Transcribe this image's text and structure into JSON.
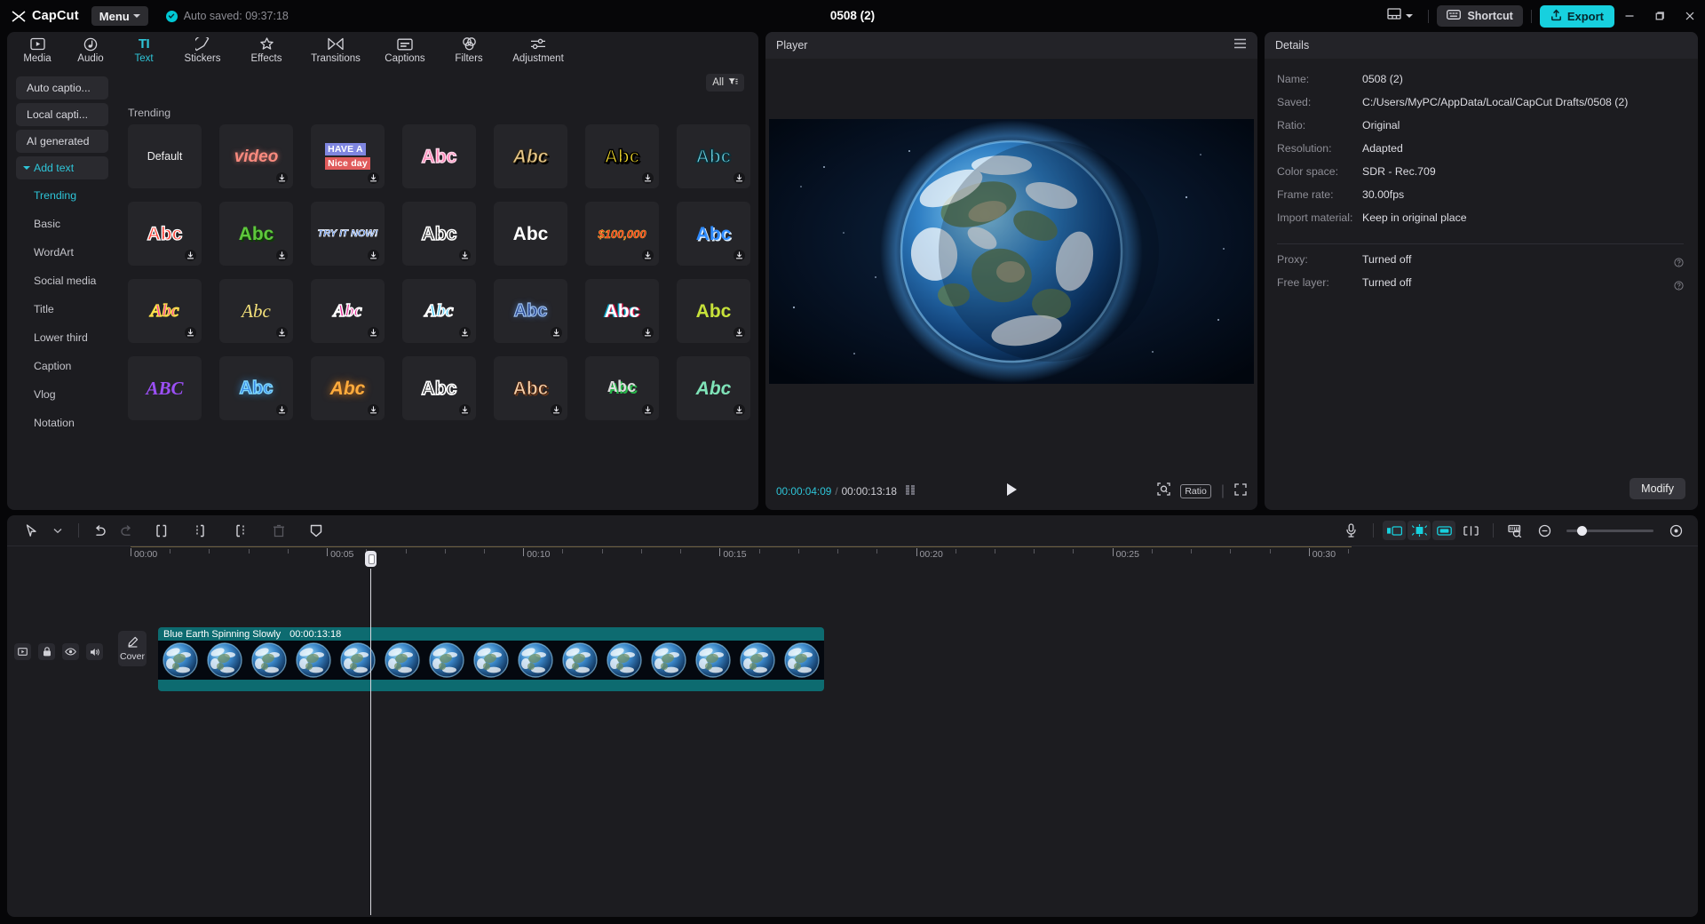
{
  "app": {
    "brand": "CapCut",
    "menu_label": "Menu",
    "autosave": "Auto  saved: 09:37:18",
    "project_title": "0508 (2)",
    "accent": "#17d0de",
    "clip_color": "#0d6b70"
  },
  "titlebar": {
    "layout_icon": "layout-icon",
    "shortcut_label": "Shortcut",
    "shortcut_icon": "keyboard-icon",
    "export_label": "Export",
    "export_icon": "upload-icon",
    "minimize": "–",
    "maximize": "❐",
    "close": "✕"
  },
  "tabs": [
    {
      "label": "Media",
      "icon": "media-icon",
      "active": false
    },
    {
      "label": "Audio",
      "icon": "audio-icon",
      "active": false
    },
    {
      "label": "Text",
      "icon": "text-icon",
      "glyph": "TI",
      "active": true
    },
    {
      "label": "Stickers",
      "icon": "stickers-icon",
      "active": false
    },
    {
      "label": "Effects",
      "icon": "effects-icon",
      "active": false
    },
    {
      "label": "Transitions",
      "icon": "transitions-icon",
      "active": false
    },
    {
      "label": "Captions",
      "icon": "captions-icon",
      "active": false
    },
    {
      "label": "Filters",
      "icon": "filters-icon",
      "active": false
    },
    {
      "label": "Adjustment",
      "icon": "adjustment-icon",
      "active": false
    }
  ],
  "sidebar": {
    "buttons": [
      {
        "label": "Auto captio...",
        "kind": "button"
      },
      {
        "label": "Local capti...",
        "kind": "button"
      },
      {
        "label": "AI generated",
        "kind": "button"
      },
      {
        "label": "Add text",
        "kind": "button",
        "expanded": true
      }
    ],
    "items": [
      {
        "label": "Trending",
        "selected": true
      },
      {
        "label": "Basic",
        "selected": false
      },
      {
        "label": "WordArt",
        "selected": false
      },
      {
        "label": "Social media",
        "selected": false
      },
      {
        "label": "Title",
        "selected": false
      },
      {
        "label": "Lower third",
        "selected": false
      },
      {
        "label": "Caption",
        "selected": false
      },
      {
        "label": "Vlog",
        "selected": false
      },
      {
        "label": "Notation",
        "selected": false
      }
    ]
  },
  "grid": {
    "filter_label": "All",
    "filter_icon": "filter-icon",
    "section_title": "Trending",
    "download_icon": "download-icon",
    "templates": [
      {
        "text": "Default",
        "style": "default",
        "download": false
      },
      {
        "text": "video",
        "style": "video-pink",
        "download": true
      },
      {
        "text": "HAVE A / Nice day",
        "style": "have-a-nice-day",
        "download": true
      },
      {
        "text": "Abc",
        "style": "pink-outline",
        "download": false
      },
      {
        "text": "Abc",
        "style": "cream-italic-shadow",
        "download": false
      },
      {
        "text": "Abc",
        "style": "yellow-block",
        "download": true
      },
      {
        "text": "Abc",
        "style": "cyan-block",
        "download": true
      },
      {
        "text": "Abc",
        "style": "red-outline",
        "download": true
      },
      {
        "text": "Abc",
        "style": "green-block",
        "download": true
      },
      {
        "text": "TRY IT NOW!",
        "style": "try-it-now",
        "download": true
      },
      {
        "text": "Abc",
        "style": "white-outline-black",
        "download": true
      },
      {
        "text": "Abc",
        "style": "white-plain",
        "download": false
      },
      {
        "text": "$100,000",
        "style": "money-red",
        "download": true
      },
      {
        "text": "Abc",
        "style": "blue-bold",
        "download": true
      },
      {
        "text": "Abc",
        "style": "pink-script",
        "download": true
      },
      {
        "text": "Abc",
        "style": "yellow-script",
        "download": true
      },
      {
        "text": "Abc",
        "style": "magenta-script",
        "download": true
      },
      {
        "text": "Abc",
        "style": "cyan-script",
        "download": true
      },
      {
        "text": "Abc",
        "style": "navy-glow",
        "download": true
      },
      {
        "text": "Abc",
        "style": "white-glitch",
        "download": true
      },
      {
        "text": "Abc",
        "style": "lime-plain",
        "download": true
      },
      {
        "text": "ABC",
        "style": "purple-brush",
        "download": false
      },
      {
        "text": "Abc",
        "style": "blue-neon",
        "download": true
      },
      {
        "text": "Abc",
        "style": "orange-glow",
        "download": true
      },
      {
        "text": "Abc",
        "style": "black-white-outline",
        "download": true
      },
      {
        "text": "Abc",
        "style": "peach-3d",
        "download": true
      },
      {
        "text": "Abc",
        "style": "green-pixel",
        "download": true
      },
      {
        "text": "Abc",
        "style": "mint-italic",
        "download": true
      }
    ]
  },
  "player": {
    "title": "Player",
    "menu_icon": "hamburger-icon",
    "current_time": "00:00:04:09",
    "separator": "/",
    "total_time": "00:00:13:18",
    "frames_icon": "frames-icon",
    "play_icon": "play-icon",
    "crop_icon": "crop-icon",
    "ratio_label": "Ratio",
    "fullscreen_icon": "fullscreen-icon"
  },
  "details": {
    "title": "Details",
    "rows": [
      {
        "key": "Name:",
        "value": "0508 (2)",
        "help": false
      },
      {
        "key": "Saved:",
        "value": "C:/Users/MyPC/AppData/Local/CapCut Drafts/0508 (2)",
        "help": false
      },
      {
        "key": "Ratio:",
        "value": "Original",
        "help": false
      },
      {
        "key": "Resolution:",
        "value": "Adapted",
        "help": false
      },
      {
        "key": "Color space:",
        "value": "SDR - Rec.709",
        "help": false
      },
      {
        "key": "Frame rate:",
        "value": "30.00fps",
        "help": false
      },
      {
        "key": "Import material:",
        "value": "Keep in original place",
        "help": false
      }
    ],
    "rows2": [
      {
        "key": "Proxy:",
        "value": "Turned off",
        "help": true
      },
      {
        "key": "Free layer:",
        "value": "Turned off",
        "help": true
      }
    ],
    "modify_label": "Modify",
    "help_icon": "help-icon"
  },
  "timeline": {
    "tools": [
      {
        "name": "select-tool",
        "icon": "cursor-icon"
      },
      {
        "name": "select-dropdown",
        "icon": "chevron-down-icon"
      },
      {
        "name": "undo",
        "icon": "undo-icon"
      },
      {
        "name": "redo",
        "icon": "redo-icon",
        "disabled": true
      },
      {
        "name": "split",
        "icon": "split-icon"
      },
      {
        "name": "trim-left",
        "icon": "trim-left-icon"
      },
      {
        "name": "trim-right",
        "icon": "trim-right-icon"
      },
      {
        "name": "delete",
        "icon": "trash-icon",
        "disabled": true
      },
      {
        "name": "mask",
        "icon": "shield-icon"
      }
    ],
    "right_tools": [
      {
        "name": "record-voiceover",
        "icon": "microphone-icon",
        "active": false
      },
      {
        "name": "auto-snap-left",
        "icon": "snap-left-icon",
        "active": true
      },
      {
        "name": "magnet-snap",
        "icon": "magnet-icon",
        "active": true
      },
      {
        "name": "link-clip",
        "icon": "link-icon",
        "active": true
      },
      {
        "name": "adjust-gap",
        "icon": "gap-icon",
        "active": false
      },
      {
        "name": "preview-thumbnails",
        "icon": "thumbnails-icon",
        "active": false
      },
      {
        "name": "zoom-out",
        "icon": "zoom-out-icon",
        "active": false
      },
      {
        "name": "zoom-in-fit",
        "icon": "fit-icon",
        "active": false
      }
    ],
    "zoom_knob_pct": 12,
    "ruler_labels": [
      "00:00",
      "00:05",
      "00:10",
      "00:15",
      "00:20",
      "00:25",
      "00:30"
    ],
    "track_head_icons": [
      "track-type-icon",
      "lock-icon",
      "eye-icon",
      "volume-icon"
    ],
    "cover_label": "Cover",
    "cover_icon": "pen-icon",
    "clip": {
      "name": "Blue Earth Spinning Slowly",
      "duration": "00:00:13:18",
      "thumb_count": 15
    },
    "playhead_time": "00:00:04:09"
  }
}
